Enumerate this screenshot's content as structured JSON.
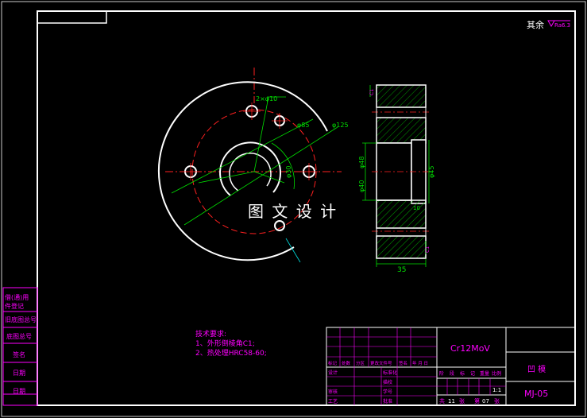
{
  "roughness_note": {
    "prefix": "其余",
    "value": "Ra6.3"
  },
  "watermark": "图 文 设 计",
  "front_view": {
    "hole_callout": "2×φ10",
    "dims": {
      "d85": "φ85",
      "d125": "φ125",
      "d30": "φ30"
    }
  },
  "section_view": {
    "dims": {
      "d40": "φ40",
      "d48": "φ48",
      "d45": "φ45",
      "w35": "35",
      "h10": "10",
      "c1": "C1"
    }
  },
  "tech_requirements": {
    "title": "技术要求:",
    "items": [
      "1、外形倒棱角C1;",
      "2、热处理HRC58-60;"
    ]
  },
  "side_labels": [
    "借(通)用",
    "件登记",
    "旧底图总号",
    "底图总号",
    "签名",
    "日期",
    "日期"
  ],
  "title_block": {
    "material": "Cr12MoV",
    "part_name": "凹  模",
    "drawing_no": "MJ-05",
    "scale": "1:1",
    "sheet_info": [
      "共",
      "11",
      "张",
      "第",
      "07",
      "张"
    ],
    "revision_headers": [
      "标记",
      "处数",
      "分区",
      "更改文件号",
      "签名",
      "年 月 日"
    ],
    "people": [
      {
        "role": "设计",
        "role2": "标准化"
      },
      {
        "role": "",
        "role2": "描校"
      },
      {
        "role": "审核",
        "role2": "学号"
      },
      {
        "role": "工艺",
        "role2": "批准"
      }
    ],
    "stage_headers": [
      "阶",
      "段",
      "标",
      "记",
      "重量",
      "比例"
    ]
  },
  "colors": {
    "frame": "#ffffff",
    "outline": "#ffffff",
    "centerline": "#ff2020",
    "dimension": "#00e000",
    "hatch": "#00ff00",
    "annotation": "#ff00ff",
    "leader": "#00e0e0"
  }
}
